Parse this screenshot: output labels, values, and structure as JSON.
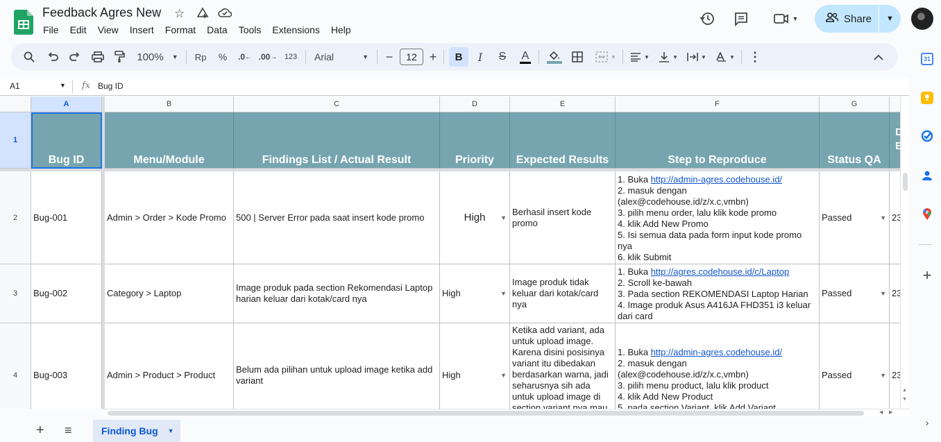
{
  "app": {
    "doc_title": "Feedback Agres New",
    "menu": [
      "File",
      "Edit",
      "View",
      "Insert",
      "Format",
      "Data",
      "Tools",
      "Extensions",
      "Help"
    ],
    "share_label": "Share"
  },
  "toolbar": {
    "zoom": "100%",
    "currency": "Rp",
    "percent": "%",
    "dec_decrease": ".0",
    "dec_increase": ".00",
    "number_format": "123",
    "font": "Arial",
    "font_size": "12",
    "bold": "B",
    "italic": "I",
    "strike": "S",
    "text_color": "A"
  },
  "formula_bar": {
    "name_box": "A1",
    "content": "Bug ID"
  },
  "columns": [
    "A",
    "B",
    "C",
    "D",
    "E",
    "F",
    "G"
  ],
  "rows": [
    "1",
    "2",
    "3",
    "4"
  ],
  "header_row": [
    "Bug ID",
    "Menu/Module",
    "Findings List / Actual Result",
    "Priority",
    "Expected Results",
    "Step to Reproduce",
    "Status QA"
  ],
  "header_partial": "D\nE",
  "data_rows": [
    {
      "id": "Bug-001",
      "module": "Admin > Order > Kode Promo",
      "finding": "500 | Server Error pada saat insert kode promo",
      "priority": "High",
      "expected": "Berhasil insert kode promo",
      "steps_link_prefix": "1. Buka ",
      "steps_link": "http://admin-agres.codehouse.id/",
      "steps_rest": "2. masuk dengan (alex@codehouse.id/z/x.c,vmbn)\n3. pilih menu order, lalu klik kode promo\n4. klik Add New Promo\n5. Isi semua data pada form input kode promo nya\n6. klik Submit",
      "status": "Passed",
      "partial": "23"
    },
    {
      "id": "Bug-002",
      "module": "Category > Laptop",
      "finding": "Image produk pada section Rekomendasi Laptop harian keluar dari kotak/card nya",
      "priority": "High",
      "expected": "Image produk tidak keluar dari kotak/card nya",
      "steps_link_prefix": "1. Buka ",
      "steps_link": "http://agres.codehouse.id/c/Laptop",
      "steps_rest": "2. Scroll ke-bawah\n3. Pada section REKOMENDASI Laptop Harian\n4. Image produk Asus A416JA FHD351 i3 keluar dari card",
      "status": "Passed",
      "partial": "23"
    },
    {
      "id": "Bug-003",
      "module": "Admin > Product > Product",
      "finding": "Belum ada pilihan untuk upload image ketika add variant",
      "priority": "High",
      "expected": "Ketika add variant, ada untuk upload image. Karena disini posisinya variant itu dibedakan berdasarkan warna, jadi seharusnya sih ada untuk upload image di section variant nya mau",
      "steps_link_prefix": "1. Buka ",
      "steps_link": "http://admin-agres.codehouse.id/",
      "steps_rest": "2. masuk dengan (alex@codehouse.id/z/x.c,vmbn)\n3. pilih menu product, lalu klik product\n4. klik Add New Product\n5. pada section Variant, klik Add Variant",
      "status": "Passed",
      "partial": "23"
    }
  ],
  "sheet_tab": "Finding Bug",
  "colors": {
    "header_fill": "#76a5af",
    "share_bg": "#c2e7ff",
    "accent": "#0b57d0"
  }
}
